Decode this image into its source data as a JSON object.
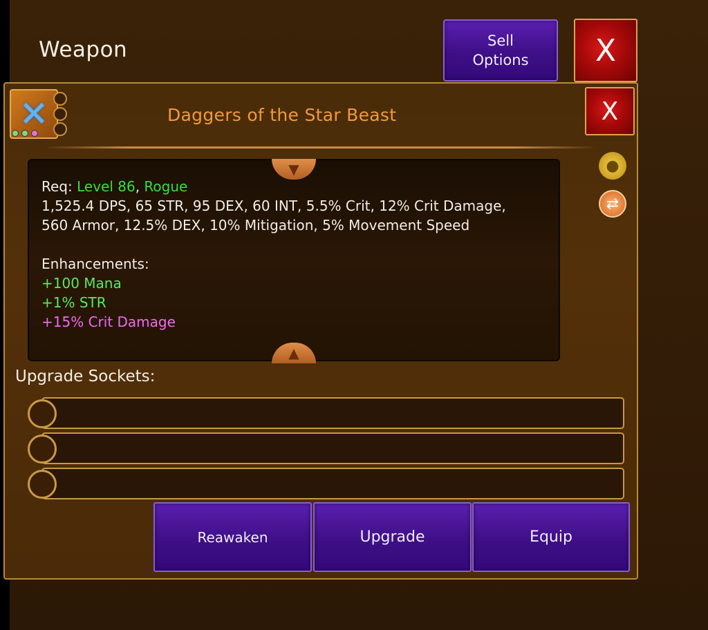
{
  "header": {
    "title": "Weapon",
    "sell_label": "Sell\nOptions",
    "close_label": "X"
  },
  "item": {
    "name": "Daggers of the Star Beast",
    "close_label": "X",
    "req_label": "Req: ",
    "req_level": "Level 86",
    "req_sep": ", ",
    "req_class": "Rogue",
    "stats_line1": "1,525.4 DPS, 65 STR, 95 DEX, 60 INT, 5.5% Crit, 12% Crit Damage,",
    "stats_line2": "560 Armor, 12.5% DEX, 10% Mitigation, 5% Movement Speed",
    "enhancements_title": "Enhancements:",
    "enhancements": [
      "+100 Mana",
      "+1% STR",
      "+15% Crit Damage"
    ]
  },
  "sockets": {
    "label": "Upgrade Sockets:"
  },
  "actions": {
    "reawaken": "Reawaken",
    "upgrade": "Upgrade",
    "equip": "Equip"
  },
  "icons": [
    "daggers-icon",
    "gold-bag-icon",
    "swap-icon",
    "scroll-up-icon",
    "scroll-down-icon",
    "close-icon"
  ],
  "colors": {
    "item_name": "#f19a3a",
    "requirement": "#35e035",
    "enhancement_green": "#5ee85e",
    "enhancement_pink": "#ec6cf0",
    "button_purple": "#3e0f86",
    "button_red": "#a80909"
  }
}
